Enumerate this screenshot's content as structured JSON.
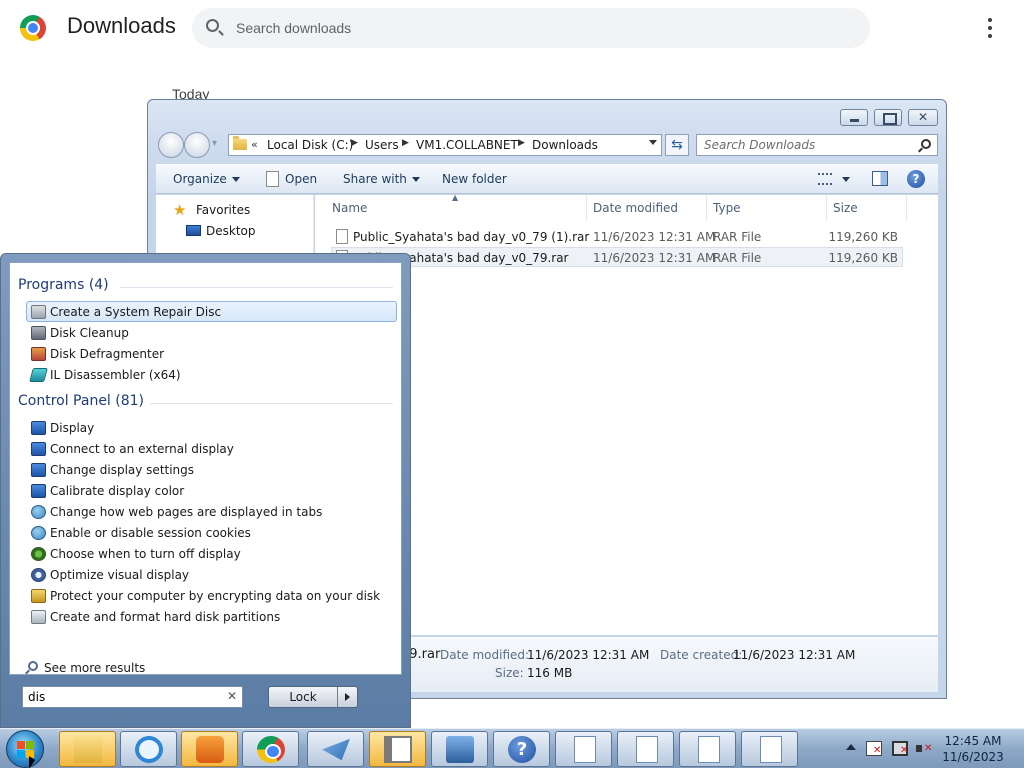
{
  "chrome": {
    "title": "Downloads",
    "search_placeholder": "Search downloads",
    "section_label": "Today"
  },
  "explorer": {
    "breadcrumb": [
      "Local Disk (C:)",
      "Users",
      "VM1.COLLABNET",
      "Downloads"
    ],
    "breadcrumb_overflow": "«",
    "search_placeholder": "Search Downloads",
    "commands": {
      "organize": "Organize",
      "open": "Open",
      "share_with": "Share with",
      "new_folder": "New folder"
    },
    "nav": {
      "favorites": "Favorites",
      "desktop": "Desktop"
    },
    "columns": {
      "name": "Name",
      "date_modified": "Date modified",
      "type": "Type",
      "size": "Size"
    },
    "files": [
      {
        "name": "Public_Syahata's bad day_v0_79 (1).rar",
        "date": "11/6/2023 12:31 AM",
        "type": "RAR File",
        "size": "119,260 KB"
      },
      {
        "name": "Public_Syahata's bad day_v0_79.rar",
        "date": "11/6/2023 12:31 AM",
        "type": "RAR File",
        "size": "119,260 KB"
      }
    ],
    "details": {
      "filename_fragment": "79.rar",
      "date_modified_label": "Date modified:",
      "date_modified": "11/6/2023 12:31 AM",
      "date_created_label": "Date created:",
      "date_created": "11/6/2023 12:31 AM",
      "size_label": "Size:",
      "size": "116 MB"
    }
  },
  "start_menu": {
    "programs_header": "Programs (4)",
    "programs": [
      {
        "label": "Create a System Repair Disc",
        "icon": "disc-icon"
      },
      {
        "label": "Disk Cleanup",
        "icon": "broom-icon"
      },
      {
        "label": "Disk Defragmenter",
        "icon": "defrag-icon"
      },
      {
        "label": "IL Disassembler (x64)",
        "icon": "ildasm-icon"
      }
    ],
    "control_panel_header": "Control Panel (81)",
    "control_panel": [
      {
        "label": "Display",
        "icon": "monitor-icon"
      },
      {
        "label": "Connect to an external display",
        "icon": "monitor-icon"
      },
      {
        "label": "Change display settings",
        "icon": "monitor-icon"
      },
      {
        "label": "Calibrate display color",
        "icon": "monitor-icon"
      },
      {
        "label": "Change how web pages are displayed in tabs",
        "icon": "globe-icon"
      },
      {
        "label": "Enable or disable session cookies",
        "icon": "globe-icon"
      },
      {
        "label": "Choose when to turn off display",
        "icon": "power-icon"
      },
      {
        "label": "Optimize visual display",
        "icon": "ease-of-access-icon"
      },
      {
        "label": "Protect your computer by encrypting data on your disk",
        "icon": "shield-icon"
      },
      {
        "label": "Create and format hard disk partitions",
        "icon": "disk-icon"
      }
    ],
    "see_more": "See more results",
    "search_value": "dis",
    "lock_label": "Lock"
  },
  "taskbar": {
    "time": "12:45 AM",
    "date": "11/6/2023"
  }
}
